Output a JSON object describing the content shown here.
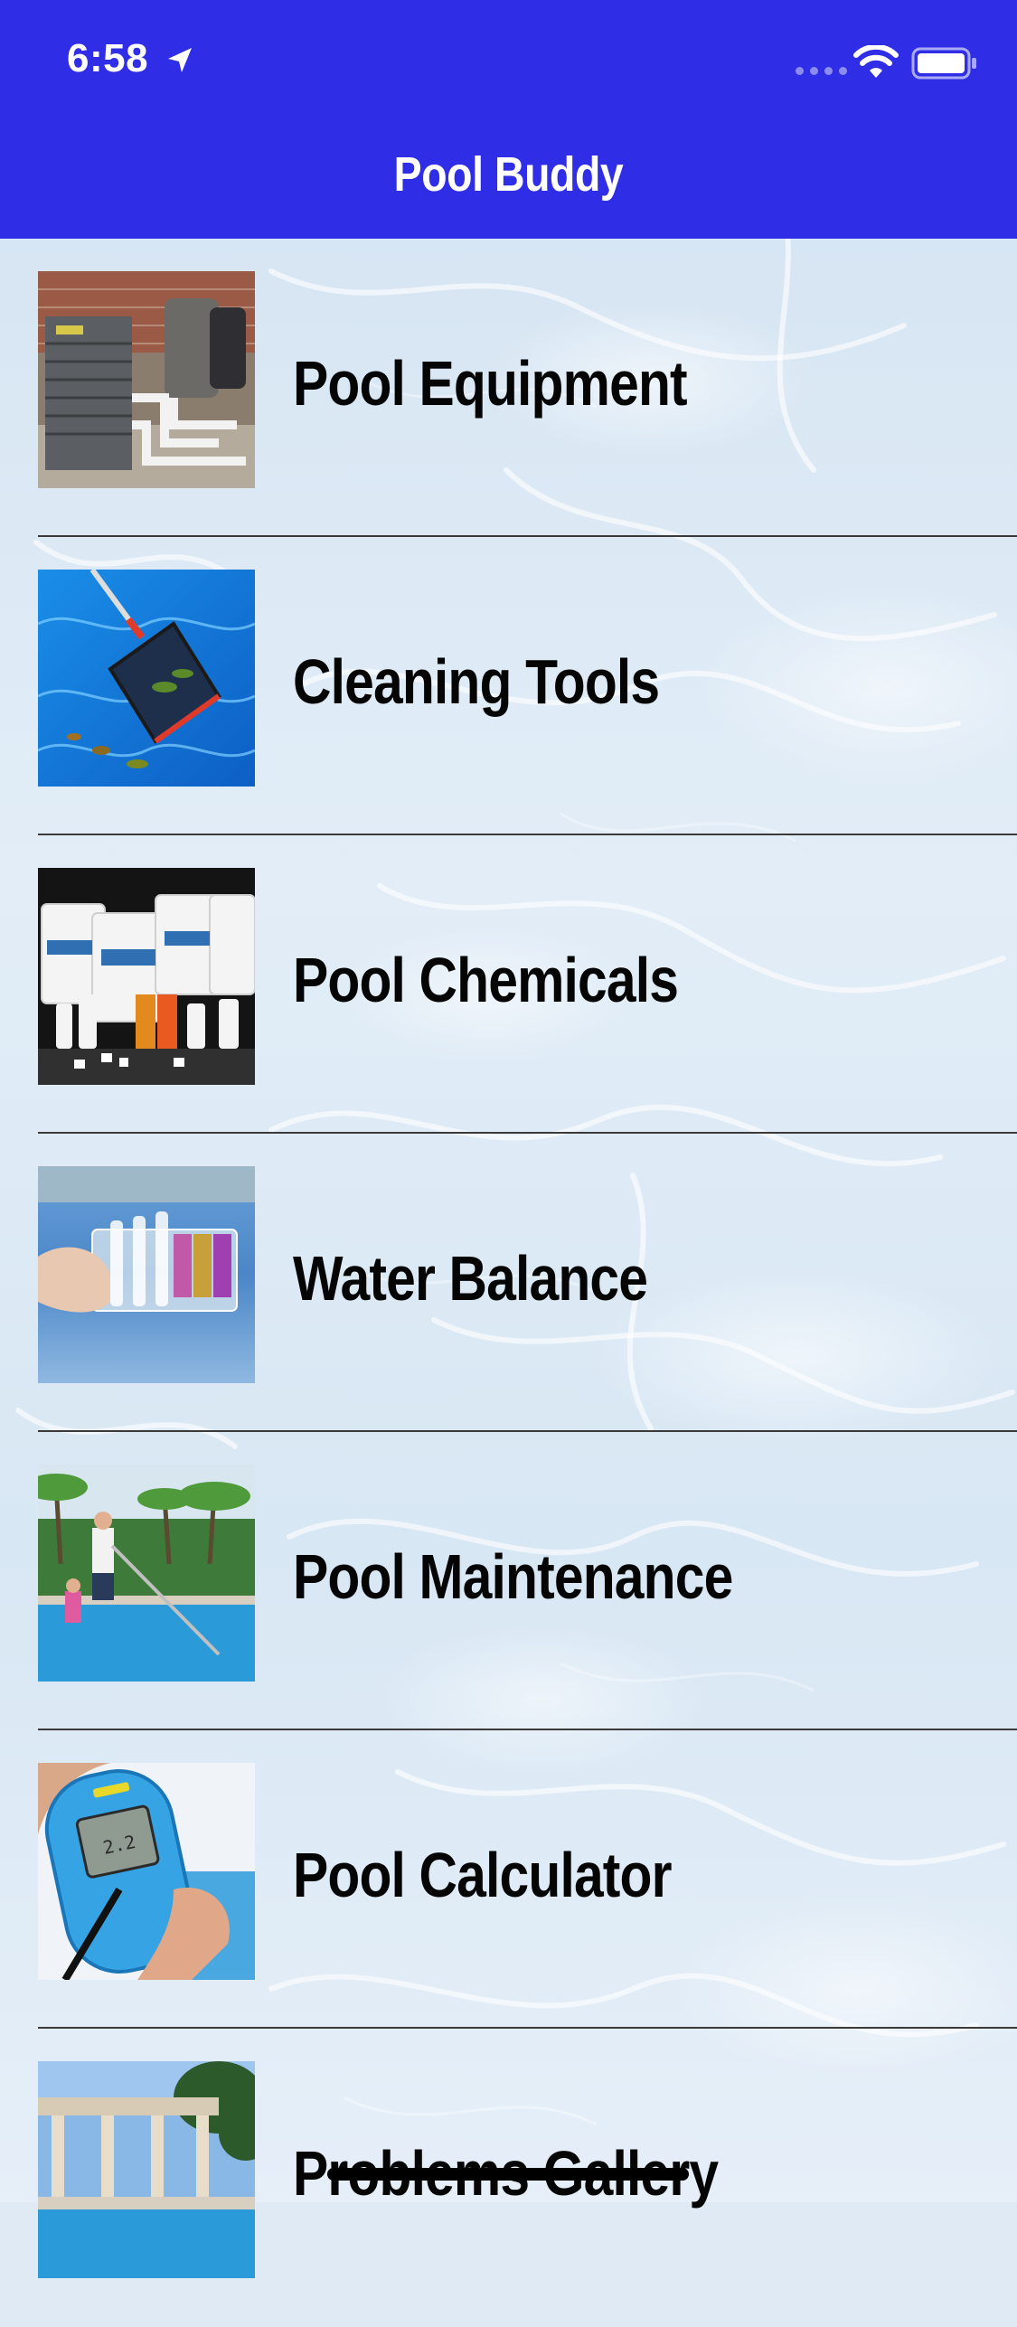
{
  "status_bar": {
    "time": "6:58",
    "icons": [
      "location-arrow-icon",
      "cellular-signal-icon",
      "wifi-icon",
      "battery-icon"
    ]
  },
  "nav": {
    "title": "Pool Buddy"
  },
  "colors": {
    "header": "#2f2ee6",
    "header_text": "#ffffff",
    "label_text": "#050505",
    "divider": "#3a3a3a"
  },
  "menu": {
    "items": [
      {
        "label": "Pool Equipment",
        "image": "pool-equipment-image"
      },
      {
        "label": "Cleaning Tools",
        "image": "cleaning-tools-image"
      },
      {
        "label": "Pool Chemicals",
        "image": "pool-chemicals-image"
      },
      {
        "label": "Water Balance",
        "image": "water-balance-image"
      },
      {
        "label": "Pool Maintenance",
        "image": "pool-maintenance-image"
      },
      {
        "label": "Pool Calculator",
        "image": "pool-calculator-image"
      },
      {
        "label": "Problems Gallery",
        "image": "problems-gallery-image"
      }
    ]
  }
}
